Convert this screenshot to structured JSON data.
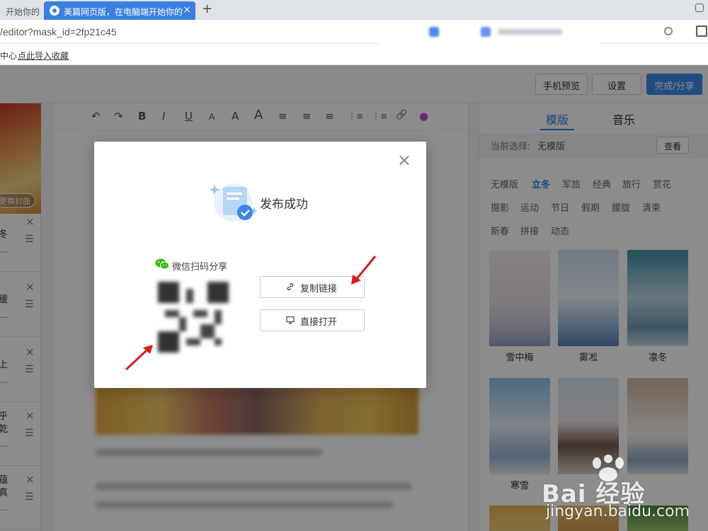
{
  "browser": {
    "tabs": [
      {
        "label": "开始你的",
        "active": false
      },
      {
        "label": "美篇网页版，在电脑端开始你的",
        "active": true
      }
    ],
    "new_tab_label": "+",
    "close_glyph": "×",
    "url": "/editor?mask_id=2fp21c45",
    "bookmarks": [
      "中心",
      "点此导入收藏"
    ]
  },
  "header": {
    "preview_label": "手机预览",
    "settings_label": "设置",
    "publish_label": "完成/分享"
  },
  "left_panel": {
    "cover_button": "更换封面",
    "items": [
      {
        "char": "冬",
        "dots": "..."
      },
      {
        "char": "缓",
        "dots": "..."
      },
      {
        "char": "上",
        "dots": "..."
      },
      {
        "char": "乎\n乾",
        "dots": "..."
      },
      {
        "char": "蕴\n真",
        "dots": "..."
      }
    ],
    "close_glyph": "×",
    "drag_glyph": "☰"
  },
  "toolbar": {
    "tools": [
      "↶",
      "↷",
      "B",
      "I",
      "U",
      "A",
      "A",
      "A",
      "≡",
      "≡",
      "≡",
      "⋮≡",
      "⋮≡",
      "🔗",
      "●"
    ]
  },
  "right_panel": {
    "tabs": [
      "模版",
      "音乐"
    ],
    "current_label": "当前选择:",
    "current_value": "无模版",
    "view_button": "查看",
    "categories": [
      "无模版",
      "立冬",
      "军旅",
      "经典",
      "旅行",
      "赏花",
      "摄影",
      "运动",
      "节日",
      "假期",
      "朦胧",
      "清柬",
      "新春",
      "拼接",
      "动态"
    ],
    "active_category": "立冬",
    "templates": [
      "雪中梅",
      "雾凇",
      "凛冬",
      "寒雪",
      "",
      ""
    ]
  },
  "dialog": {
    "title": "发布成功",
    "close_glyph": "×",
    "wechat_label": "微信扫码分享",
    "copy_link_label": "复制链接",
    "open_label": "直接打开"
  },
  "watermark": {
    "text": "Bai 经验",
    "url": "jingyan.baidu.com"
  },
  "colors": {
    "accent": "#3c8be8",
    "tab_active": "#3a7ee0",
    "arrow": "#e0191b",
    "wechat": "#2dc100"
  }
}
